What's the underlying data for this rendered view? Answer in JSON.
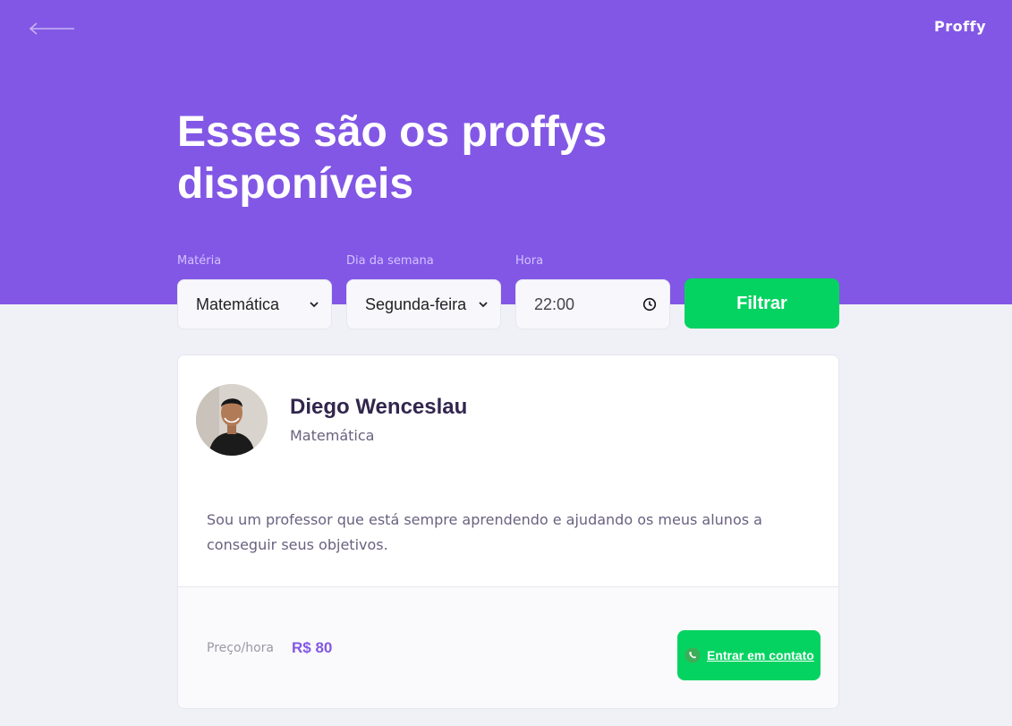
{
  "header": {
    "logo": "Proffy",
    "title": "Esses são os proffys disponíveis",
    "back_icon": "arrow-left-icon"
  },
  "filters": {
    "subject": {
      "label": "Matéria",
      "value": "Matemática"
    },
    "weekday": {
      "label": "Dia da semana",
      "value": "Segunda-feira"
    },
    "time": {
      "label": "Hora",
      "value": "22:00"
    },
    "submit_label": "Filtrar"
  },
  "teacher": {
    "name": "Diego Wenceslau",
    "subject": "Matemática",
    "bio": "Sou um professor que está sempre aprendendo e ajudando os meus alunos a conseguir seus objetivos.",
    "price_label": "Preço/hora",
    "price": "R$ 80",
    "contact_label": "Entrar em contato"
  },
  "colors": {
    "primary": "#8257e5",
    "secondary": "#04d361",
    "background": "#f0f0f7",
    "title_text": "#32264d",
    "body_text": "#6a6180"
  }
}
